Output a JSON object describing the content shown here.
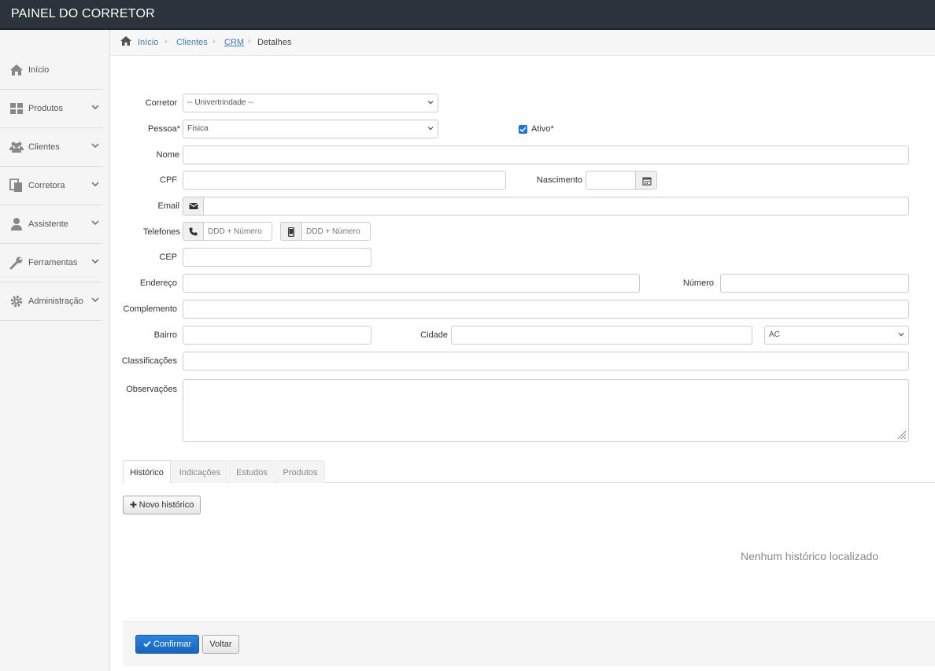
{
  "app": {
    "title": "PAINEL DO CORRETOR"
  },
  "sidebar": {
    "items": [
      {
        "label": "Início",
        "icon": "home-icon"
      },
      {
        "label": "Produtos",
        "icon": "grid-icon"
      },
      {
        "label": "Clientes",
        "icon": "users-icon"
      },
      {
        "label": "Corretora",
        "icon": "copy-icon"
      },
      {
        "label": "Assistente",
        "icon": "user-icon"
      },
      {
        "label": "Ferramentas",
        "icon": "wrench-icon"
      },
      {
        "label": "Administração",
        "icon": "gear-icon"
      }
    ]
  },
  "breadcrumb": {
    "home": "Início",
    "clientes": "Clientes",
    "crm": "CRM",
    "current": "Detalhes"
  },
  "form": {
    "corretor": {
      "label": "Corretor",
      "value": "-- Univertrindade --"
    },
    "pessoa": {
      "label": "Pessoa*",
      "value": "Física"
    },
    "ativo": {
      "label": "Ativo*",
      "checked": true
    },
    "nome": {
      "label": "Nome",
      "value": ""
    },
    "cpf": {
      "label": "CPF",
      "value": ""
    },
    "nascimento": {
      "label": "Nascimento",
      "value": ""
    },
    "email": {
      "label": "Email",
      "value": ""
    },
    "telefones": {
      "label": "Telefones",
      "placeholder_phone": "DDD + Número",
      "placeholder_mobile": "DDD + Número"
    },
    "cep": {
      "label": "CEP",
      "value": ""
    },
    "endereco": {
      "label": "Endereço",
      "value": ""
    },
    "numero": {
      "label": "Número",
      "value": ""
    },
    "complemento": {
      "label": "Complemento",
      "value": ""
    },
    "bairro": {
      "label": "Bairro",
      "value": ""
    },
    "cidade": {
      "label": "Cidade",
      "value": ""
    },
    "uf": {
      "value": "AC"
    },
    "classificacoes": {
      "label": "Classificações",
      "value": ""
    },
    "observacoes": {
      "label": "Observações",
      "value": ""
    }
  },
  "tabs": [
    "Histórico",
    "Indicações",
    "Estudos",
    "Produtos"
  ],
  "historico": {
    "new_button": "Novo histórico",
    "empty_message": "Nenhum histórico localizado"
  },
  "footer": {
    "confirm": "Confirmar",
    "back": "Voltar"
  },
  "colors": {
    "topbar": "#2c333c",
    "accent": "#1a73e8",
    "link": "#3d7fc0"
  }
}
